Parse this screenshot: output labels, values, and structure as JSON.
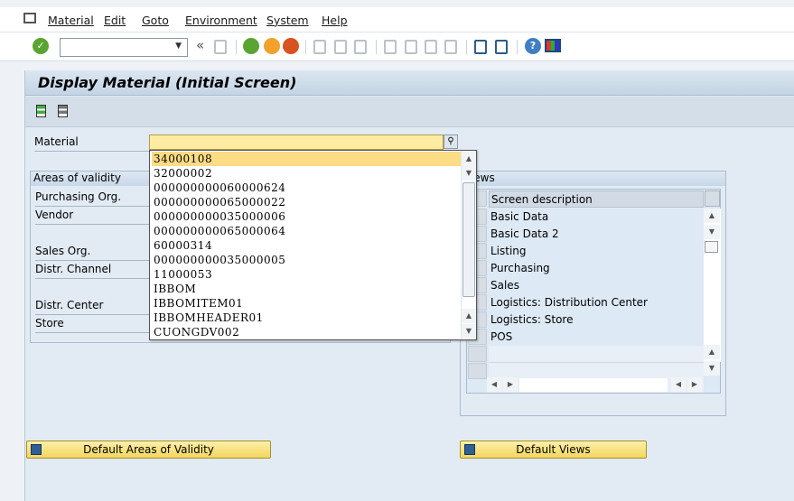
{
  "menu": {
    "items": [
      "Material",
      "Edit",
      "Goto",
      "Environment",
      "System",
      "Help"
    ]
  },
  "toolbar": {
    "command_value": "",
    "icons": [
      "enter-icon",
      "back-icon",
      "exit-icon",
      "cancel-icon",
      "print-icon",
      "find-icon",
      "find-next-icon",
      "first-page-icon",
      "previous-page-icon",
      "next-page-icon",
      "last-page-icon",
      "create-session-icon",
      "shortcut-icon",
      "help-icon",
      "customize-layout-icon"
    ]
  },
  "page": {
    "title": "Display Material (Initial Screen)"
  },
  "form": {
    "material_label": "Material",
    "material_value": ""
  },
  "areas": {
    "title": "Areas of validity",
    "labels": [
      "Purchasing Org.",
      "Vendor",
      "Sales Org.",
      "Distr. Channel",
      "Distr. Center",
      "Store"
    ]
  },
  "dropdown": {
    "items": [
      "34000108",
      "32000002",
      "000000000060000624",
      "000000000065000022",
      "000000000035000006",
      "000000000065000064",
      "60000314",
      "000000000035000005",
      "11000053",
      "IBBOM",
      "IBBOMITEM01",
      "IBBOMHEADER01",
      "CUONGDV002"
    ]
  },
  "views": {
    "title": "Views",
    "column_header": "Screen description",
    "rows": [
      "Basic Data",
      "Basic Data 2",
      "Listing",
      "Purchasing",
      "Sales",
      "Logistics: Distribution Center",
      "Logistics: Store",
      "POS"
    ]
  },
  "buttons": {
    "default_areas": "Default Areas of Validity",
    "default_views": "Default Views"
  },
  "colors": {
    "field_required": "#fdeca2",
    "selected_item": "#fcdc84",
    "button": "#f3d65e"
  }
}
